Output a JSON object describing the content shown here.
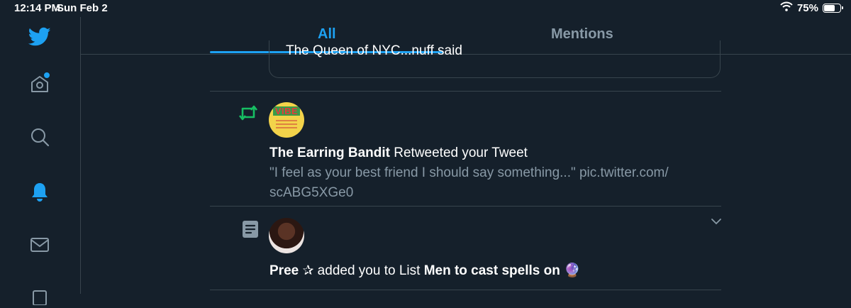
{
  "status_bar": {
    "time": "12:14 PM",
    "date": "Sun Feb 2",
    "battery": "75%",
    "battery_level": 0.75
  },
  "sidebar": {
    "items": [
      {
        "icon": "twitter-logo-icon"
      },
      {
        "icon": "home-icon",
        "has_notification": true
      },
      {
        "icon": "search-icon"
      },
      {
        "icon": "bell-icon",
        "active": true
      },
      {
        "icon": "mail-icon"
      }
    ]
  },
  "tabs": [
    {
      "label": "All",
      "active": true
    },
    {
      "label": "Mentions",
      "active": false
    }
  ],
  "colors": {
    "background": "#15202b",
    "accent": "#1da1f2",
    "divider": "#38444d",
    "muted": "#8899a6",
    "retweet": "#17bf63"
  },
  "feed": {
    "quote_text": "The Queen of NYC...nuff said",
    "retweet": {
      "icon": "retweet-icon",
      "user": "The Earring Bandit",
      "action": " Retweeted your Tweet",
      "tweet_line1": "\"I feel as your best friend I should say something...\" pic.twitter.com/",
      "tweet_line2": "scABG5XGe0",
      "avatar_text": "VIBE"
    },
    "list_add": {
      "icon": "list-icon",
      "user": "Pree ✰",
      "action": " added you to List ",
      "list_name": "Men to cast spells on",
      "emoji": "🔮"
    }
  }
}
